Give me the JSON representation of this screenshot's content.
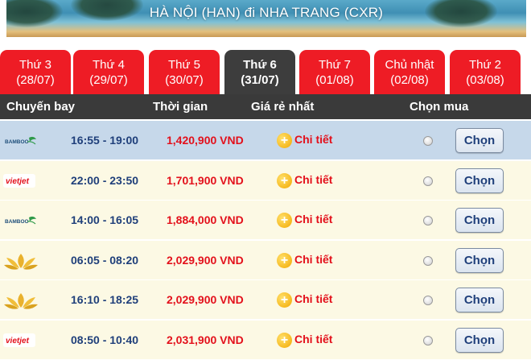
{
  "route_title": "HÀ NỘI (HAN) đi NHA TRANG (CXR)",
  "tabs": [
    {
      "day": "Thứ 3",
      "date": "(28/07)",
      "active": false
    },
    {
      "day": "Thứ 4",
      "date": "(29/07)",
      "active": false
    },
    {
      "day": "Thứ 5",
      "date": "(30/07)",
      "active": false
    },
    {
      "day": "Thứ 6",
      "date": "(31/07)",
      "active": true
    },
    {
      "day": "Thứ 7",
      "date": "(01/08)",
      "active": false
    },
    {
      "day": "Chủ nhật",
      "date": "(02/08)",
      "active": false
    },
    {
      "day": "Thứ 2",
      "date": "(03/08)",
      "active": false
    }
  ],
  "columns": {
    "flight": "Chuyến bay",
    "time": "Thời gian",
    "price": "Giá rẻ nhất",
    "select": "Chọn mua"
  },
  "flights": [
    {
      "airline": "bamboo",
      "logo_text": "BAMBOO",
      "time": "16:55 - 19:00",
      "price": "1,420,900 VND",
      "detail": "Chi tiết",
      "button": "Chọn",
      "highlight": true
    },
    {
      "airline": "vietjet",
      "logo_text": "vietjet",
      "time": "22:00 - 23:50",
      "price": "1,701,900 VND",
      "detail": "Chi tiết",
      "button": "Chọn",
      "highlight": false
    },
    {
      "airline": "bamboo",
      "logo_text": "BAMBOO",
      "time": "14:00 - 16:05",
      "price": "1,884,000 VND",
      "detail": "Chi tiết",
      "button": "Chọn",
      "highlight": false
    },
    {
      "airline": "vietnam-airlines",
      "logo_text": "",
      "time": "06:05 - 08:20",
      "price": "2,029,900 VND",
      "detail": "Chi tiết",
      "button": "Chọn",
      "highlight": false
    },
    {
      "airline": "vietnam-airlines",
      "logo_text": "",
      "time": "16:10 - 18:25",
      "price": "2,029,900 VND",
      "detail": "Chi tiết",
      "button": "Chọn",
      "highlight": false
    },
    {
      "airline": "vietjet",
      "logo_text": "vietjet",
      "time": "08:50 - 10:40",
      "price": "2,031,900 VND",
      "detail": "Chi tiết",
      "button": "Chọn",
      "highlight": false
    }
  ],
  "colors": {
    "tab": "#ee1c25",
    "tab_active": "#3d3d3d",
    "header": "#3a3a3a",
    "row": "#fcf9e4",
    "row_highlight": "#c6d8ea",
    "price": "#e3101b",
    "time": "#1f3f7a"
  },
  "icons": {
    "plus": "plus-circle-icon"
  }
}
